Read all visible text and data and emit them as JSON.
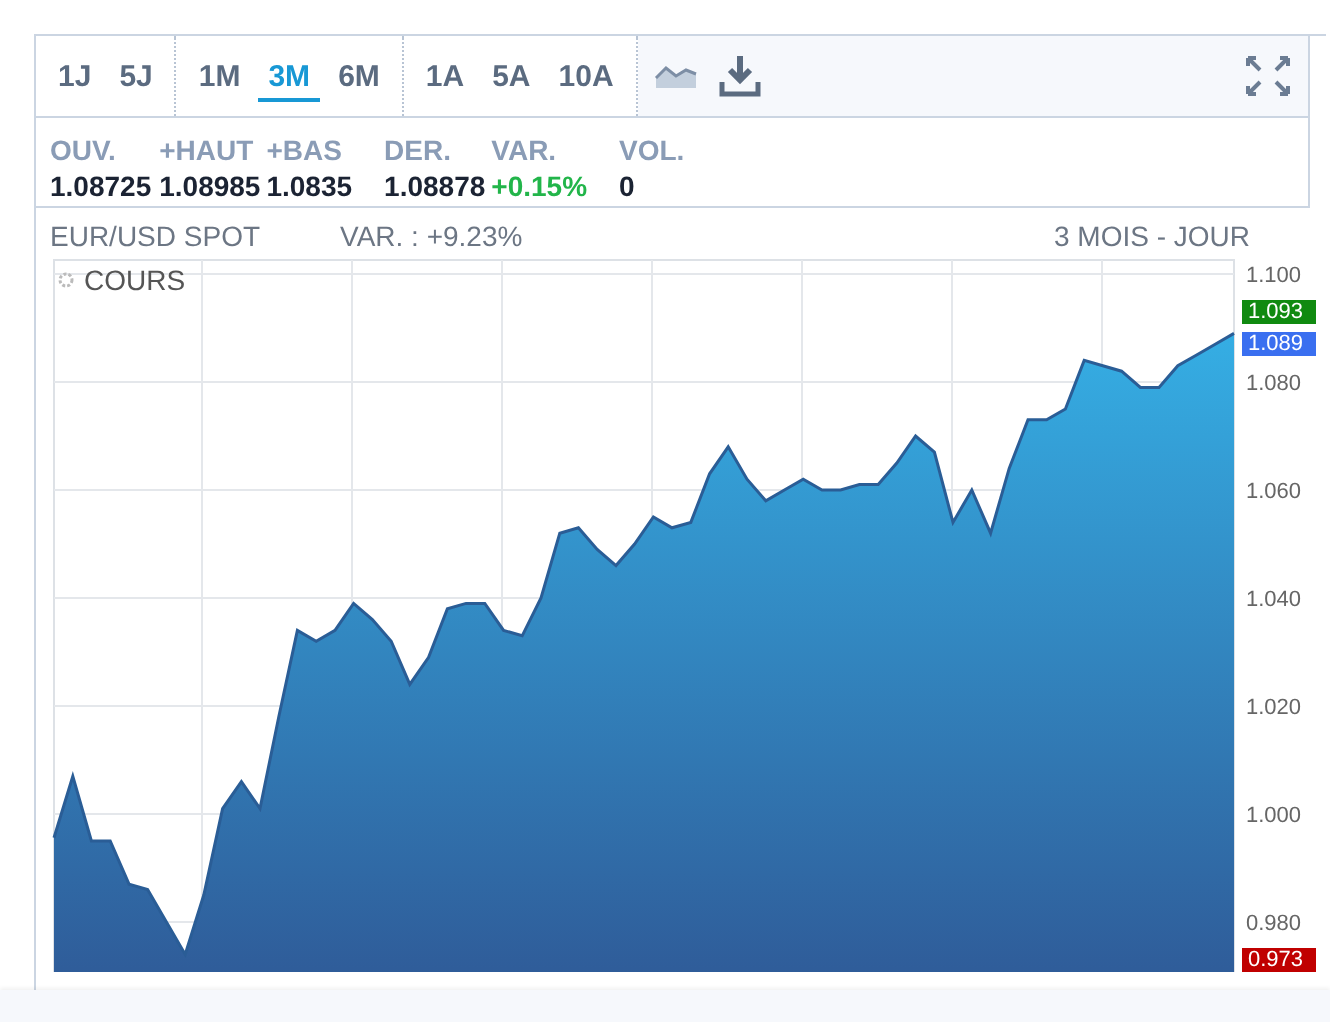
{
  "toolbar": {
    "period_groups": [
      [
        {
          "label": "1J",
          "selected": false
        },
        {
          "label": "5J",
          "selected": false
        }
      ],
      [
        {
          "label": "1M",
          "selected": false
        },
        {
          "label": "3M",
          "selected": true
        },
        {
          "label": "6M",
          "selected": false
        }
      ],
      [
        {
          "label": "1A",
          "selected": false
        },
        {
          "label": "5A",
          "selected": false
        },
        {
          "label": "10A",
          "selected": false
        }
      ]
    ]
  },
  "stats": [
    {
      "label": "OUV.",
      "value": "1.08725",
      "color": "#1b2333"
    },
    {
      "label": "+HAUT",
      "value": "1.08985",
      "color": "#1b2333"
    },
    {
      "label": "+BAS",
      "value": "1.0835",
      "color": "#1b2333"
    },
    {
      "label": "DER.",
      "value": "1.08878",
      "color": "#1b2333"
    },
    {
      "label": "VAR.",
      "value": "+0.15%",
      "color": "#22b54a"
    },
    {
      "label": "VOL.",
      "value": "0",
      "color": "#1b2333"
    }
  ],
  "chart": {
    "instrument": "EUR/USD SPOT",
    "change": "VAR. : +9.23%",
    "period": "3 MOIS - JOUR",
    "price_tags": [
      {
        "text": "1.093",
        "color": "#108a10"
      },
      {
        "text": "1.089",
        "color": "#3a6ff0"
      },
      {
        "text": "0.973",
        "color": "#c00000"
      }
    ],
    "chart_data": {
      "type": "area",
      "ylim": [
        0.97,
        1.102
      ],
      "grid": true,
      "yticks": [
        {
          "value": 0.98,
          "label": "0.980"
        },
        {
          "value": 1.0,
          "label": "1.000"
        },
        {
          "value": 1.02,
          "label": "1.020"
        },
        {
          "value": 1.04,
          "label": "1.040"
        },
        {
          "value": 1.06,
          "label": "1.060"
        },
        {
          "value": 1.08,
          "label": "1.080"
        },
        {
          "value": 1.1,
          "label": "1.100"
        }
      ],
      "series": [
        {
          "name": "COURS",
          "color": "#2a5d96",
          "values": [
            0.9956,
            1.007,
            0.995,
            0.995,
            0.987,
            0.986,
            0.98,
            0.974,
            0.985,
            1.001,
            1.006,
            1.001,
            1.018,
            1.034,
            1.032,
            1.034,
            1.039,
            1.036,
            1.032,
            1.024,
            1.029,
            1.038,
            1.039,
            1.039,
            1.034,
            1.033,
            1.04,
            1.052,
            1.053,
            1.049,
            1.046,
            1.05,
            1.055,
            1.053,
            1.054,
            1.063,
            1.068,
            1.062,
            1.058,
            1.06,
            1.062,
            1.06,
            1.06,
            1.061,
            1.061,
            1.065,
            1.07,
            1.067,
            1.054,
            1.06,
            1.052,
            1.064,
            1.073,
            1.073,
            1.075,
            1.084,
            1.083,
            1.082,
            1.079,
            1.079,
            1.083,
            1.085,
            1.087,
            1.089
          ]
        }
      ]
    }
  }
}
